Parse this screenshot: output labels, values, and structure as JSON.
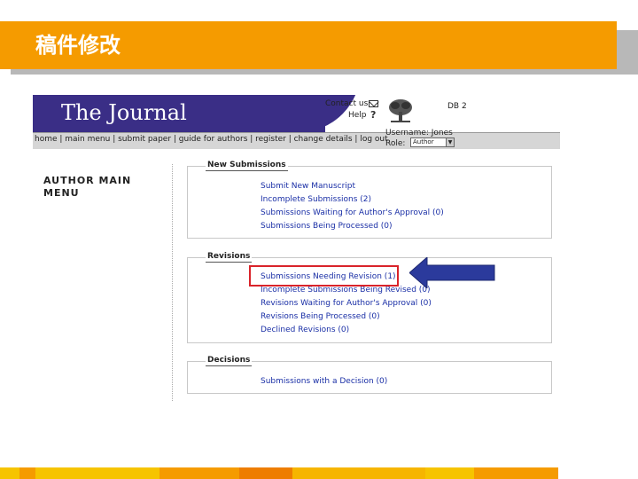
{
  "slide": {
    "title": "稿件修改"
  },
  "journal": {
    "title": "The Journal",
    "contact_label": "Contact us",
    "help_label": "Help",
    "help_icon": "?",
    "db_label": "DB 2",
    "username_label": "Username: Jones",
    "role_label": "Role:",
    "role_value": "Author",
    "nav_links": "home | main menu | submit paper | guide for authors | register | change details | log out",
    "menu_heading": "AUTHOR MAIN MENU",
    "sections": {
      "new_submissions": {
        "title": "New Submissions",
        "items": [
          "Submit New Manuscript",
          "Incomplete Submissions (2)",
          "Submissions Waiting for Author's Approval (0)",
          "Submissions Being Processed (0)"
        ]
      },
      "revisions": {
        "title": "Revisions",
        "items": [
          "Submissions Needing Revision (1)",
          "Incomplete Submissions Being Revised (0)",
          "Revisions Waiting for Author's Approval (0)",
          "Revisions Being Processed (0)",
          "Declined Revisions (0)"
        ]
      },
      "decisions": {
        "title": "Decisions",
        "items": [
          "Submissions with a Decision (0)"
        ]
      }
    }
  },
  "colors": {
    "banner": "#f59b00",
    "journal_purple": "#3a2e86",
    "highlight": "#d9232a",
    "arrow": "#2b3a9c",
    "link": "#1a2fa6"
  },
  "icons": {
    "mail": "mail-icon",
    "help": "help-icon",
    "logo": "elsevier-tree-logo",
    "arrow": "left-arrow-icon",
    "select": "chevron-down-icon"
  }
}
